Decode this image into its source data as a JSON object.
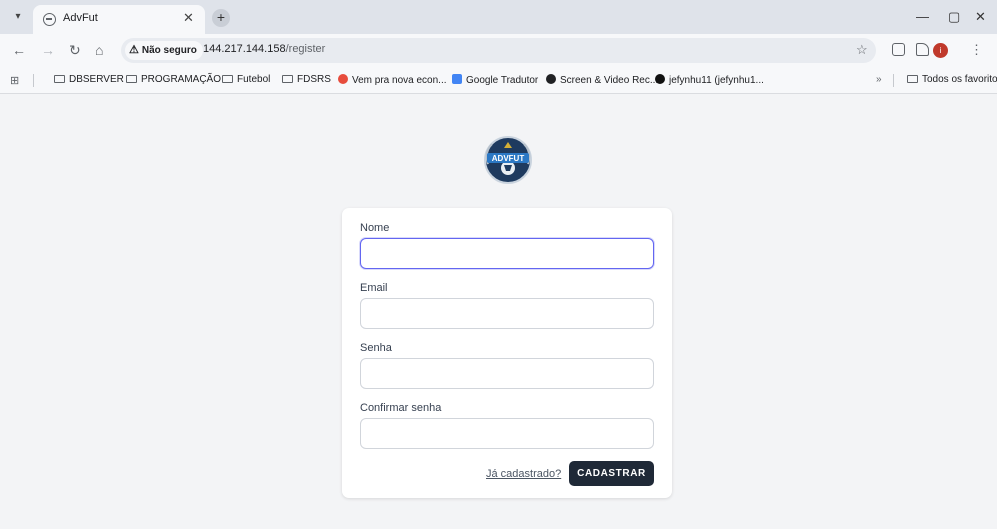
{
  "browser": {
    "tab_title": "AdvFut",
    "security_label": "Não seguro",
    "url_host": "144.217.144.158",
    "url_path": "/register",
    "profile_initial": "i"
  },
  "bookmarks": {
    "items": [
      {
        "label": "DBSERVER",
        "icon": "folder-icon"
      },
      {
        "label": "PROGRAMAÇÃO",
        "icon": "folder-icon"
      },
      {
        "label": "Futebol",
        "icon": "folder-icon"
      },
      {
        "label": "FDSRS",
        "icon": "folder-icon"
      },
      {
        "label": "Vem pra nova econ...",
        "icon": "red-circle-icon"
      },
      {
        "label": "Google Tradutor",
        "icon": "translate-icon"
      },
      {
        "label": "Screen & Video Rec...",
        "icon": "record-icon"
      },
      {
        "label": "jefynhu11 (jefynhu1...",
        "icon": "github-icon"
      }
    ],
    "overflow": "»",
    "all_bookmarks": "Todos os favoritos"
  },
  "logo": {
    "text": "ADVFUT"
  },
  "form": {
    "fields": [
      {
        "label": "Nome",
        "value": ""
      },
      {
        "label": "Email",
        "value": ""
      },
      {
        "label": "Senha",
        "value": ""
      },
      {
        "label": "Confirmar senha",
        "value": ""
      }
    ],
    "login_link": "Já cadastrado?",
    "submit_label": "CADASTRAR"
  },
  "colors": {
    "primary_button": "#1f2937",
    "focus_ring": "#6366f1",
    "page_background": "#f3f4f6"
  }
}
